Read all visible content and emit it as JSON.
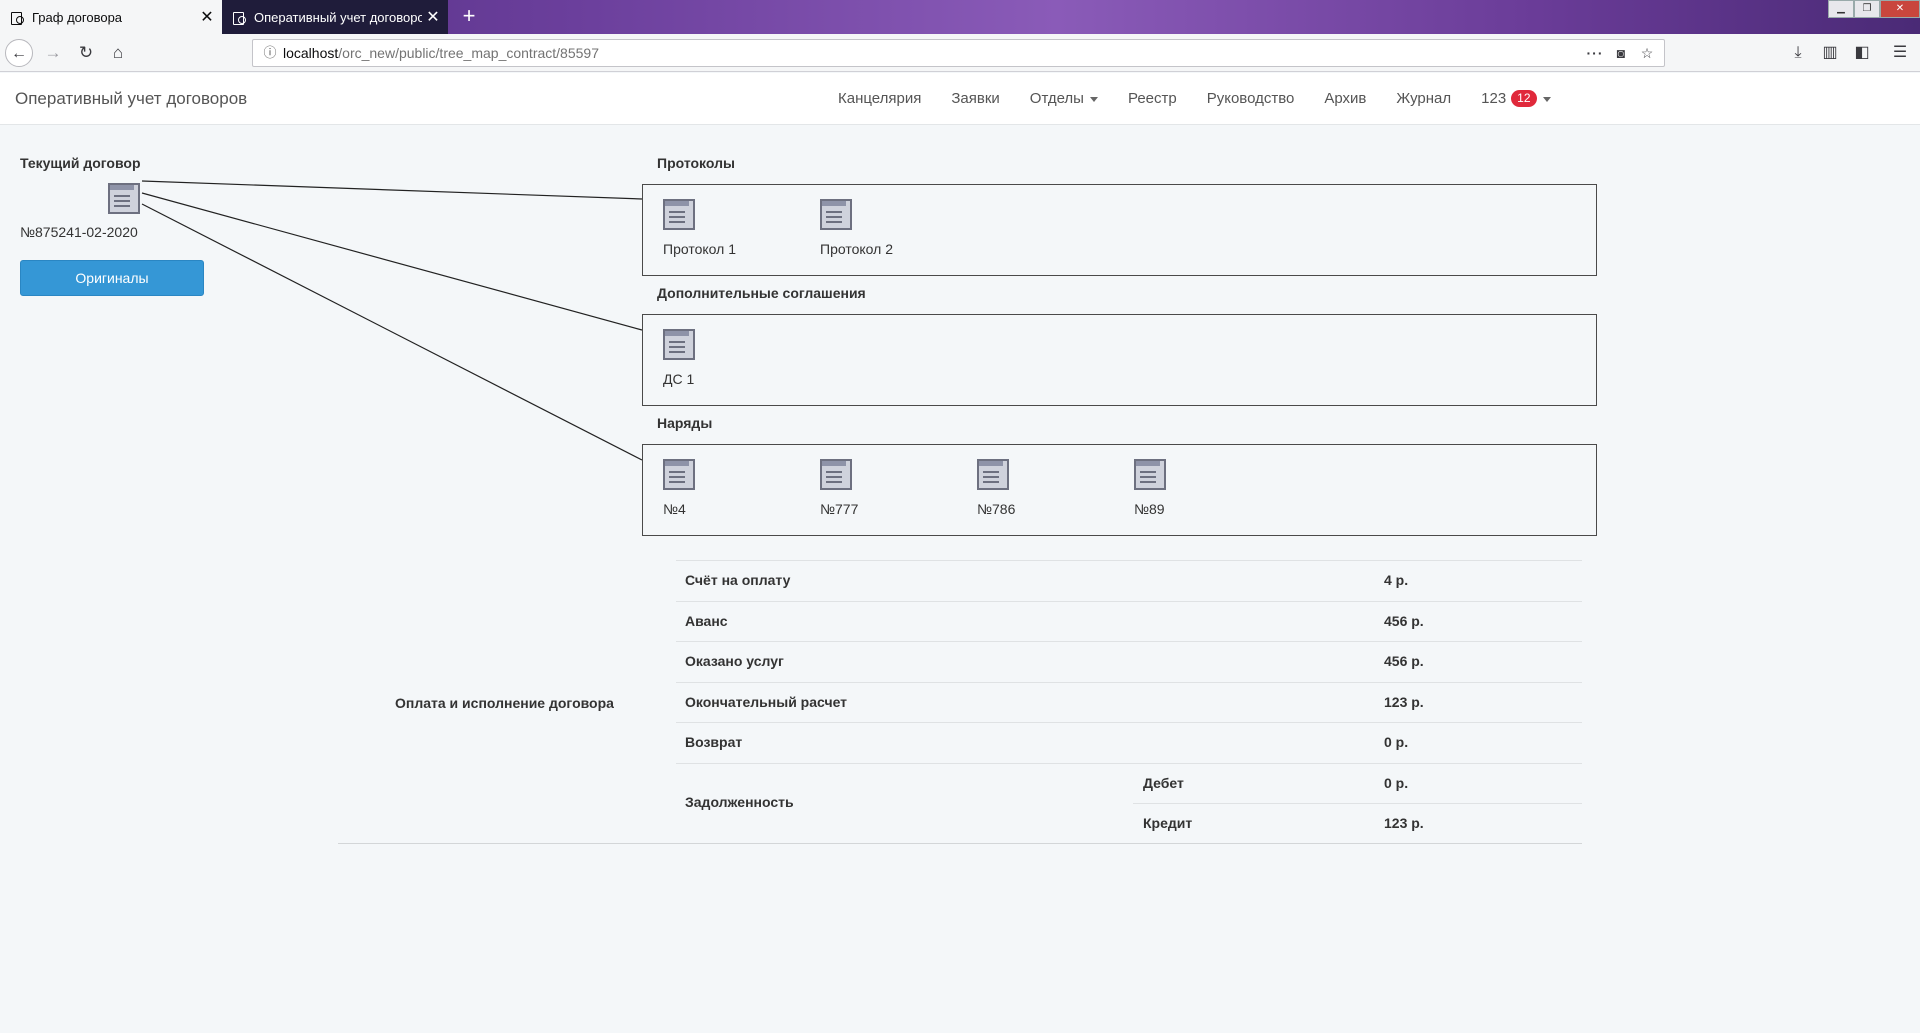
{
  "browser": {
    "tabs": [
      {
        "title": "Граф договора",
        "active": true
      },
      {
        "title": "Оперативный учет договоров",
        "active": false
      }
    ],
    "url_host": "localhost",
    "url_path": "/orc_new/public/tree_map_contract/85597"
  },
  "header": {
    "brand": "Оперативный учет договоров",
    "menu": [
      "Канцелярия",
      "Заявки",
      "Отделы",
      "Реестр",
      "Руководство",
      "Архив",
      "Журнал"
    ],
    "user": "123",
    "badge": "12"
  },
  "contract": {
    "heading": "Текущий договор",
    "number": "№875241-02-2020",
    "originals_button": "Оригиналы"
  },
  "sections": {
    "protocols": {
      "title": "Протоколы",
      "items": [
        "Протокол 1",
        "Протокол 2"
      ]
    },
    "agreements": {
      "title": "Дополнительные соглашения",
      "items": [
        "ДС 1"
      ]
    },
    "orders": {
      "title": "Наряды",
      "items": [
        "№4",
        "№777",
        "№786",
        "№89"
      ]
    }
  },
  "payment": {
    "title": "Оплата и исполнение договора",
    "rows": [
      {
        "label": "Счёт на оплату",
        "value": "4 р."
      },
      {
        "label": "Аванс",
        "value": "456 р."
      },
      {
        "label": "Оказано услуг",
        "value": "456 р."
      },
      {
        "label": "Окончательный расчет",
        "value": "123 р."
      },
      {
        "label": "Возврат",
        "value": "0 р."
      }
    ],
    "debt": {
      "label": "Задолженность",
      "rows": [
        {
          "label": "Дебет",
          "value": "0 р."
        },
        {
          "label": "Кредит",
          "value": "123 р."
        }
      ]
    }
  }
}
